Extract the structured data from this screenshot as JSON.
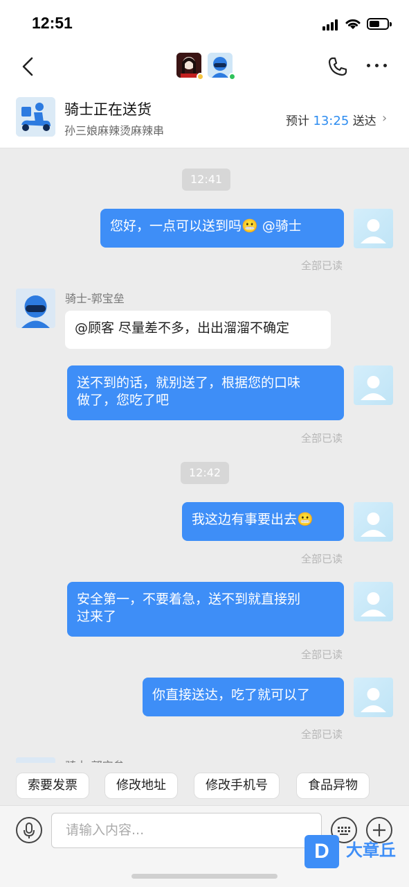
{
  "status_bar": {
    "time": "12:51"
  },
  "header": {
    "order_title": "骑士正在送货",
    "order_shop": "孙三娘麻辣烫麻辣串",
    "eta_prefix": "预计",
    "eta_time": "13:25",
    "eta_suffix": "送达",
    "eta_arrow": "›"
  },
  "chat": {
    "time_1": "12:41",
    "msg_1": "您好，一点可以送到吗😬 @骑士",
    "read_1": "全部已读",
    "rider_name_1": "骑士-郭宝垒",
    "rider_msg_1": "@顾客 尽量差不多，出出溜溜不确定",
    "msg_2_line1": "送不到的话，就别送了，根据您的口味",
    "msg_2_line2": "做了，您吃了吧",
    "read_2": "全部已读",
    "time_2": "12:42",
    "msg_3": "我这边有事要出去😬",
    "read_3": "全部已读",
    "msg_4_line1": "安全第一，不要着急，送不到就直接别",
    "msg_4_line2": "过来了",
    "read_4": "全部已读",
    "msg_5": "你直接送达，吃了就可以了",
    "read_5": "全部已读",
    "rider_name_2": "骑士-郭宝垒"
  },
  "quick_replies": [
    "索要发票",
    "修改地址",
    "修改手机号",
    "食品异物"
  ],
  "input": {
    "placeholder": "请输入内容..."
  },
  "watermark": {
    "logo": "D",
    "text": "大章丘"
  },
  "colors": {
    "accent": "#3e8ef7",
    "eta_time": "#2d8cf0",
    "background": "#ececec"
  },
  "icons": [
    "back-icon",
    "phone-icon",
    "more-icon",
    "mic-icon",
    "keyboard-icon",
    "plus-icon"
  ]
}
